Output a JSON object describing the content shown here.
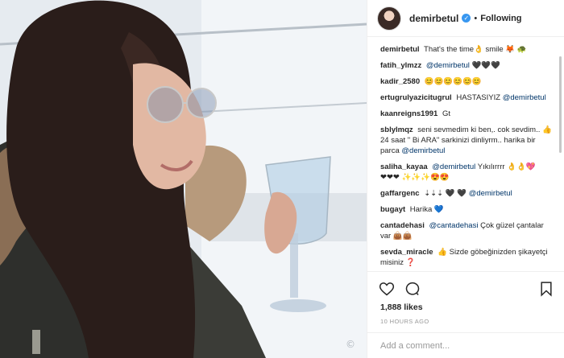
{
  "photo": {
    "alt": "Post photo",
    "watermark": "©"
  },
  "header": {
    "username": "demirbetul",
    "verified_mark": "✓",
    "separator": "•",
    "follow_status": "Following"
  },
  "comments": [
    {
      "user": "demirbetul",
      "text": "That's the time👌 smile 🦊 🐢"
    },
    {
      "user": "fatih_ylmzz",
      "mention": "@demirbetul",
      "text": " 🖤🖤🖤"
    },
    {
      "user": "kadir_2580",
      "text": "😊😊😊😊😊😊"
    },
    {
      "user": "ertugrulyazicitugrul",
      "text": "HASTASIYIZ ",
      "mention": "@demirbetul"
    },
    {
      "user": "kaanreigns1991",
      "text": "Gt"
    },
    {
      "user": "sblylmqz",
      "text": "seni sevmedim ki ben,. cok sevdim.. 👍 24 saat \" Bi ARA\" sarkinizi dinliyrm.. harika bir parca ",
      "mention": "@demirbetul"
    },
    {
      "user": "saliha_kayaa",
      "mention": "@demirbetul",
      "text": " Yıkılırrrr 👌👌💖"
    },
    {
      "user": "",
      "text": "❤❤❤ ✨✨✨😍😍"
    },
    {
      "user": "gaffargenc",
      "text": "⇣⇣⇣ 🖤 🖤 ",
      "mention": "@demirbetul"
    },
    {
      "user": "bugayt",
      "text": "Harika 💙"
    },
    {
      "user": "cantadehasi",
      "mention": "@cantadehasi",
      "text": " Çok güzel çantalar var 👜👜"
    },
    {
      "user": "sevda_miracle",
      "text": "👍 Sizde göbeğinizden şikayetçi misiniz ❓"
    }
  ],
  "actions": {
    "like_icon": "heart-icon",
    "comment_icon": "comment-icon",
    "save_icon": "bookmark-icon"
  },
  "likes": "1,888 likes",
  "time": "10 HOURS AGO",
  "add_comment": {
    "placeholder": "Add a comment..."
  }
}
